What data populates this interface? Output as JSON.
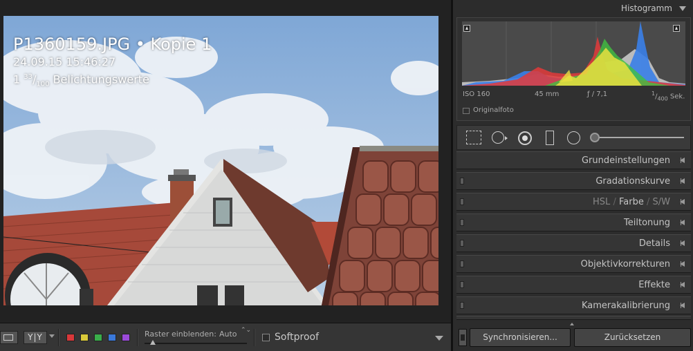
{
  "photo_overlay": {
    "filename": "P1360159.JPG • Kopie 1",
    "datetime": "24.09.15 15:46:27",
    "exposure_prefix": "1 ",
    "exposure_numerator": "33",
    "exposure_slash": "/",
    "exposure_denominator": "100",
    "exposure_suffix": " Belichtungswerte"
  },
  "toolbar": {
    "view_mode_icon": "loupe-view-icon",
    "compare_label": "Y|Y",
    "color_labels": [
      "#d9383a",
      "#d9c93a",
      "#3aae4a",
      "#3a78d9",
      "#9a4ad9"
    ],
    "raster_label": "Raster einblenden:",
    "raster_value": "Auto",
    "raster_value_arrows": "⌃⌄",
    "softproof_label": "Softproof",
    "softproof_checked": false
  },
  "histogram": {
    "title": "Histogramm",
    "iso": "ISO 160",
    "focal_length": "45 mm",
    "aperture": "ƒ / 7,1",
    "shutter_numerator": "1",
    "shutter_slash": "/",
    "shutter_denominator": "400",
    "shutter_unit": " Sek.",
    "original_photo_label": "Originalfoto",
    "original_photo_checked": false
  },
  "tools": [
    "crop-overlay-icon",
    "spot-removal-icon",
    "red-eye-icon",
    "graduated-filter-icon",
    "radial-filter-icon",
    "adjustment-brush-icon"
  ],
  "panels": {
    "grundeinstellungen": "Grundeinstellungen",
    "gradationskurve": "Gradationskurve",
    "hsl": "HSL",
    "farbe": "Farbe",
    "sw": "S/W",
    "slash": "/",
    "teiltonung": "Teiltonung",
    "details": "Details",
    "objektiv": "Objektivkorrekturen",
    "effekte": "Effekte",
    "kamera": "Kamerakalibrierung"
  },
  "buttons": {
    "sync_label": "Synchronisieren...",
    "reset_label": "Zurücksetzen"
  },
  "colors": {
    "panel_bg": "#2c2c2c",
    "histogram_red": "#e23a3a",
    "histogram_yellow": "#e8e040",
    "histogram_green": "#40c040",
    "histogram_blue": "#3a80e8"
  }
}
